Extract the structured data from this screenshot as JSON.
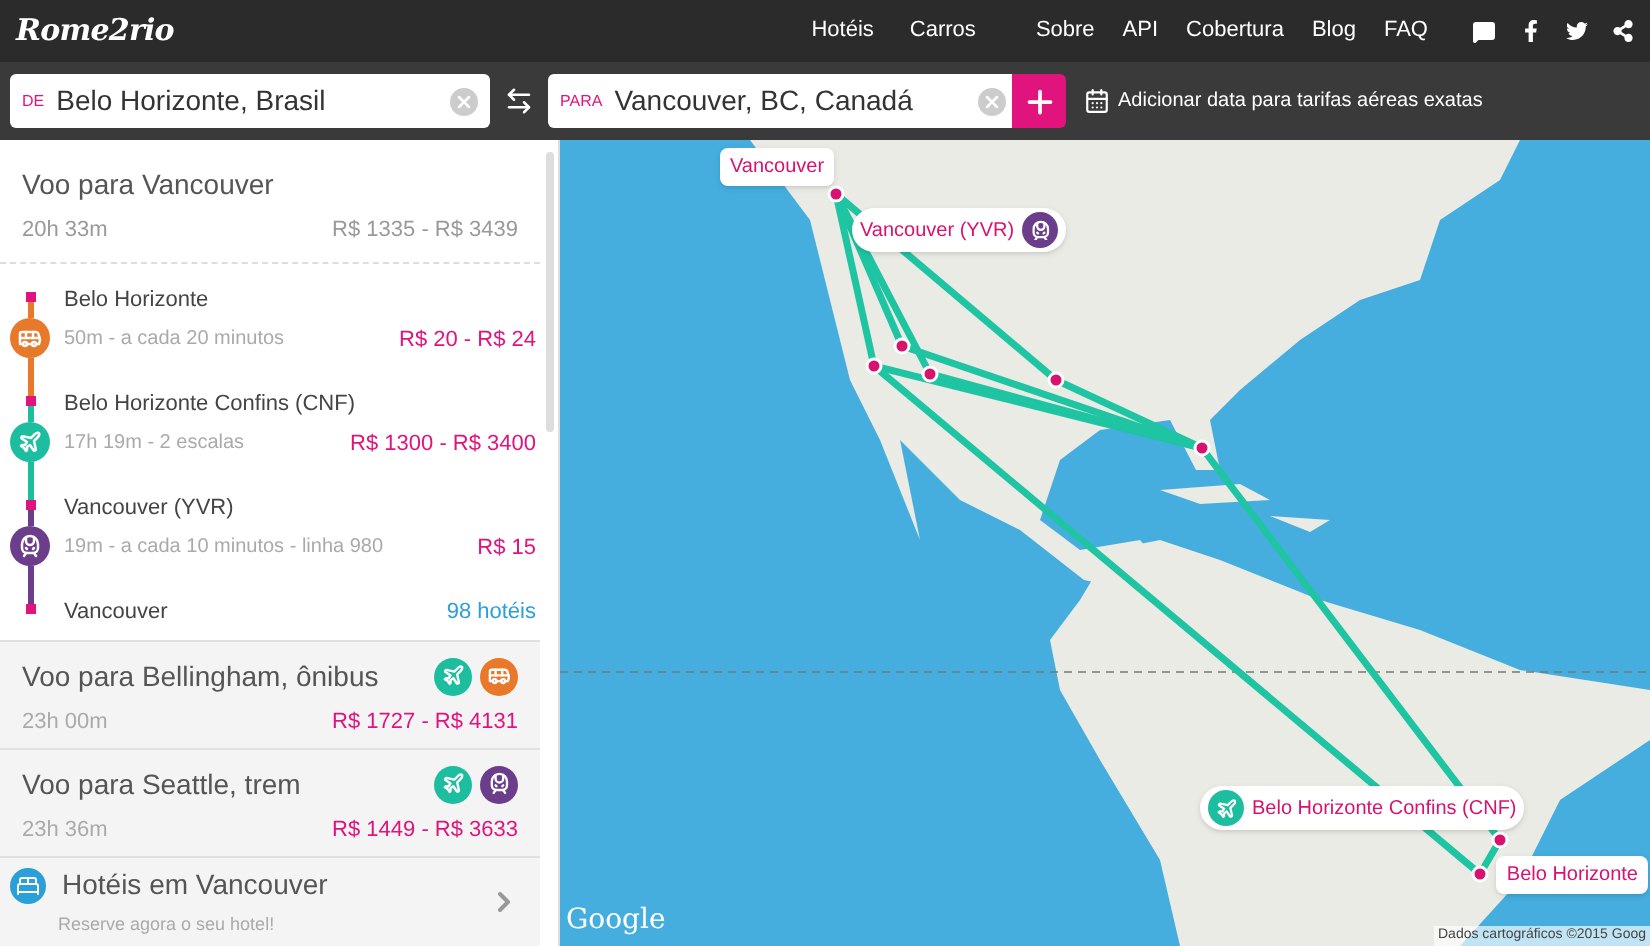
{
  "header": {
    "logo": "Rome2rio",
    "nav_primary": [
      "Hotéis",
      "Carros"
    ],
    "nav_secondary": [
      "Sobre",
      "API",
      "Cobertura",
      "Blog",
      "FAQ"
    ]
  },
  "search": {
    "from": {
      "tag": "DE",
      "value": "Belo Horizonte, Brasil"
    },
    "to": {
      "tag": "PARA",
      "value": "Vancouver, BC, Canadá"
    },
    "add_date": "Adicionar data para tarifas aéreas exatas"
  },
  "selected_route": {
    "title": "Voo para Vancouver",
    "duration": "20h 33m",
    "price": "R$ 1335 - R$ 3439",
    "segments": [
      {
        "kind": "bus",
        "place": "Belo Horizonte",
        "detail": "50m - a cada 20 minutos",
        "price": "R$ 20 - R$ 24"
      },
      {
        "kind": "flight",
        "place": "Belo Horizonte Confins (CNF)",
        "detail": "17h 19m - 2 escalas",
        "price": "R$ 1300 - R$ 3400"
      },
      {
        "kind": "train",
        "place": "Vancouver (YVR)",
        "detail": "19m - a cada 10 minutos - linha 980",
        "price": "R$ 15"
      }
    ],
    "destination": {
      "place": "Vancouver",
      "hotels": "98 hotéis"
    }
  },
  "other_routes": [
    {
      "title": "Voo para Bellingham, ônibus",
      "duration": "23h 00m",
      "price": "R$ 1727 - R$ 4131",
      "modes": [
        {
          "kind": "flight"
        },
        {
          "kind": "bus"
        }
      ]
    },
    {
      "title": "Voo para Seattle, trem",
      "duration": "23h 36m",
      "price": "R$ 1449 - R$ 3633",
      "modes": [
        {
          "kind": "flight"
        },
        {
          "kind": "train"
        }
      ]
    }
  ],
  "hotels": {
    "title": "Hotéis em Vancouver",
    "subtitle": "Reserve agora o seu hotel!"
  },
  "map": {
    "pins": [
      {
        "label": "Vancouver",
        "kind": "plain"
      },
      {
        "label": "Vancouver (YVR)",
        "kind": "train"
      },
      {
        "label": "Belo Horizonte Confins (CNF)",
        "kind": "flight"
      },
      {
        "label": "Belo Horizonte",
        "kind": "plain"
      }
    ],
    "logo": "Google",
    "attribution": "Dados cartográficos ©2015 Goog"
  }
}
